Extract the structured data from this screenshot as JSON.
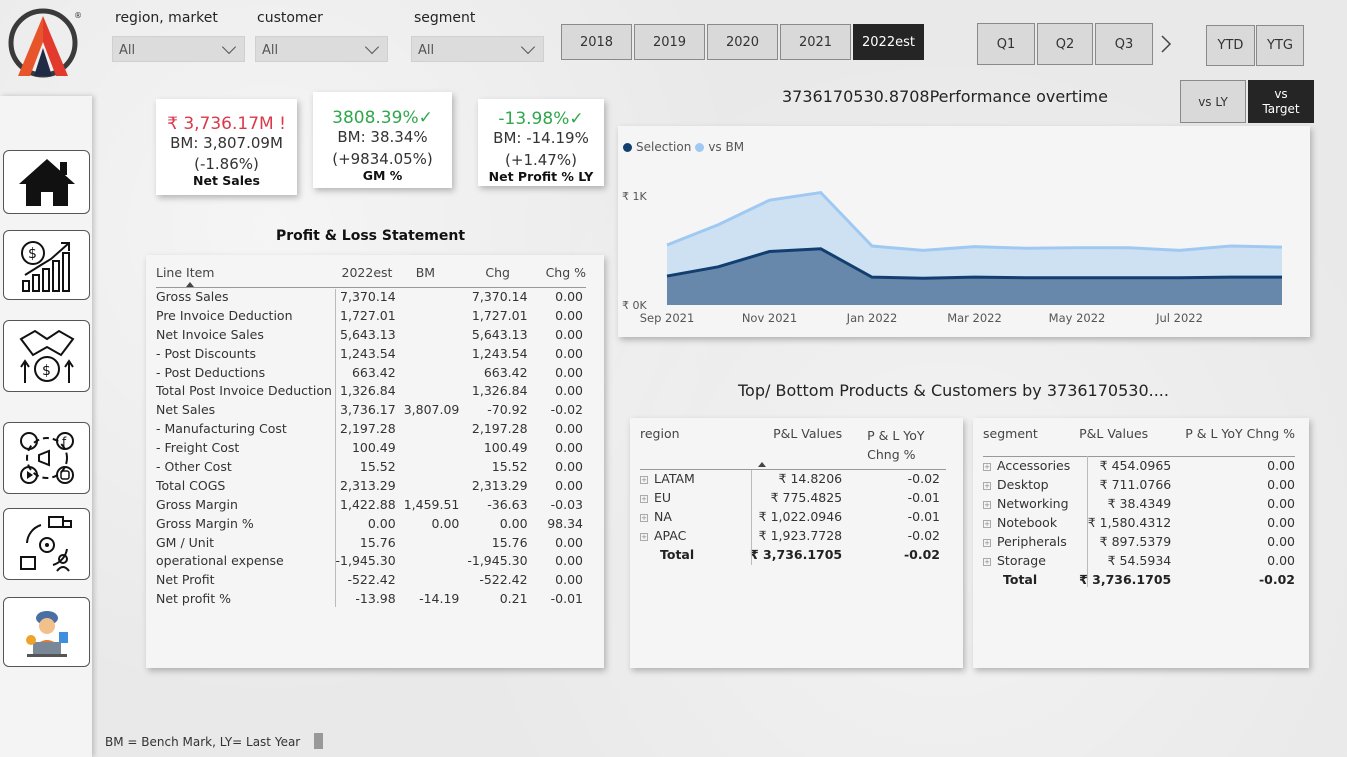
{
  "slicers": [
    {
      "label": "region, market",
      "value": "All"
    },
    {
      "label": "customer",
      "value": "All"
    },
    {
      "label": "segment",
      "value": "All"
    }
  ],
  "years": [
    "2018",
    "2019",
    "2020",
    "2021",
    "2022est"
  ],
  "selected_year": "2022est",
  "quarters": [
    "Q1",
    "Q2",
    "Q3"
  ],
  "period_buttons": [
    "YTD",
    "YTG"
  ],
  "compare_buttons": {
    "vs_ly": "vs LY",
    "vs_target_line1": "vs",
    "vs_target_line2": "Target"
  },
  "kpis": [
    {
      "main": "₹ 3,736.17M !",
      "bm": "BM: 3,807.09M",
      "chg": "(-1.86%)",
      "title": "Net Sales",
      "color": "#d9394a"
    },
    {
      "main": "3808.39%✓",
      "bm": "BM: 38.34%",
      "chg": "(+9834.05%)",
      "title": "GM %",
      "color": "#2ea84a"
    },
    {
      "main": "-13.98%✓",
      "bm": "BM: -14.19%",
      "chg": "(+1.47%)",
      "title": "Net Profit % LY",
      "color": "#2ea84a"
    }
  ],
  "pl": {
    "title": "Profit & Loss Statement",
    "headers": [
      "Line Item",
      "2022est",
      "BM",
      "Chg",
      "Chg %"
    ],
    "rows": [
      [
        "Gross Sales",
        "7,370.14",
        "",
        "7,370.14",
        "0.00"
      ],
      [
        "Pre Invoice Deduction",
        "1,727.01",
        "",
        "1,727.01",
        "0.00"
      ],
      [
        "Net Invoice Sales",
        "5,643.13",
        "",
        "5,643.13",
        "0.00"
      ],
      [
        "- Post Discounts",
        "1,243.54",
        "",
        "1,243.54",
        "0.00"
      ],
      [
        "- Post Deductions",
        "663.42",
        "",
        "663.42",
        "0.00"
      ],
      [
        "Total Post Invoice Deduction",
        "1,326.84",
        "",
        "1,326.84",
        "0.00"
      ],
      [
        "Net Sales",
        "3,736.17",
        "3,807.09",
        "-70.92",
        "-0.02"
      ],
      [
        "- Manufacturing Cost",
        "2,197.28",
        "",
        "2,197.28",
        "0.00"
      ],
      [
        "- Freight Cost",
        "100.49",
        "",
        "100.49",
        "0.00"
      ],
      [
        "- Other Cost",
        "15.52",
        "",
        "15.52",
        "0.00"
      ],
      [
        "Total COGS",
        "2,313.29",
        "",
        "2,313.29",
        "0.00"
      ],
      [
        "Gross Margin",
        "1,422.88",
        "1,459.51",
        "-36.63",
        "-0.03"
      ],
      [
        "Gross Margin %",
        "0.00",
        "0.00",
        "0.00",
        "98.34"
      ],
      [
        "GM / Unit",
        "15.76",
        "",
        "15.76",
        "0.00"
      ],
      [
        "operational expense",
        "-1,945.30",
        "",
        "-1,945.30",
        "0.00"
      ],
      [
        "Net Profit",
        "-522.42",
        "",
        "-522.42",
        "0.00"
      ],
      [
        "Net profit %",
        "-13.98",
        "-14.19",
        "0.21",
        "-0.01"
      ]
    ]
  },
  "chart_title": "3736170530.8708Performance overtime",
  "chart_data": {
    "type": "area",
    "series": [
      {
        "name": "Selection",
        "color": "#123f70",
        "values": [
          265,
          350,
          490,
          515,
          255,
          245,
          255,
          250,
          250,
          250,
          250,
          255,
          255
        ]
      },
      {
        "name": "vs BM",
        "color": "#9fc9f2",
        "values": [
          550,
          735,
          960,
          1030,
          540,
          500,
          535,
          520,
          525,
          525,
          500,
          540,
          530
        ]
      }
    ],
    "x_ticks": [
      "Sep 2021",
      "Nov 2021",
      "Jan 2022",
      "Mar 2022",
      "May 2022",
      "Jul 2022"
    ],
    "y_ticks": [
      "₹ 0K",
      "₹ 1K"
    ],
    "ylim": [
      0,
      1200
    ]
  },
  "tb_title": "Top/ Bottom Products & Customers by 3736170530....",
  "region_table": {
    "headers": [
      "region",
      "P&L Values",
      "P & L YoY",
      "Chng %"
    ],
    "rows": [
      [
        "LATAM",
        "₹ 14.8206",
        "-0.02"
      ],
      [
        "EU",
        "₹ 775.4825",
        "-0.01"
      ],
      [
        "NA",
        "₹ 1,022.0946",
        "-0.01"
      ],
      [
        "APAC",
        "₹ 1,923.7728",
        "-0.02"
      ]
    ],
    "total": [
      "Total",
      "₹ 3,736.1705",
      "-0.02"
    ]
  },
  "segment_table": {
    "headers": [
      "segment",
      "P&L Values",
      "P & L YoY Chng %"
    ],
    "rows": [
      [
        "Accessories",
        "₹ 454.0965",
        "0.00"
      ],
      [
        "Desktop",
        "₹ 711.0766",
        "0.00"
      ],
      [
        "Networking",
        "₹ 38.4349",
        "0.00"
      ],
      [
        "Notebook",
        "₹ 1,580.4312",
        "0.00"
      ],
      [
        "Peripherals",
        "₹ 897.5379",
        "0.00"
      ],
      [
        "Storage",
        "₹ 54.5934",
        "0.00"
      ]
    ],
    "total": [
      "Total",
      "₹ 3,736.1705",
      "-0.02"
    ]
  },
  "footnote": "BM = Bench Mark, LY= Last Year"
}
